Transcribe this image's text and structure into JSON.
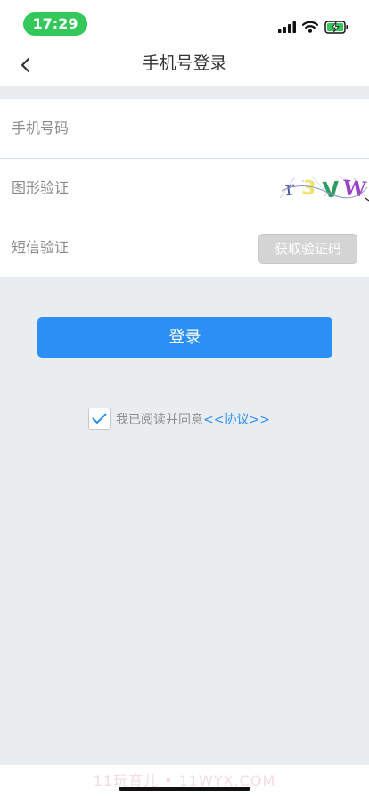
{
  "status_bar": {
    "time": "17:29",
    "icons": [
      "cellular-signal-icon",
      "wifi-icon",
      "battery-charging-icon"
    ],
    "battery_color": "#34c759"
  },
  "nav": {
    "back_icon": "chevron-left-icon",
    "title": "手机号登录"
  },
  "form": {
    "phone_label": "手机号码",
    "captcha_label": "图形验证",
    "captcha_text": "r3VW",
    "sms_label": "短信验证",
    "sms_button": "获取验证码"
  },
  "login_button": "登录",
  "agreement": {
    "checked": true,
    "text": "我已阅读并同意",
    "link": "<<协议>>"
  },
  "watermark": "11玩育儿 • 11WYX.COM",
  "colors": {
    "accent": "#2b8ff5",
    "background": "#eaedf0",
    "disabled_button": "#d4d4d4"
  }
}
